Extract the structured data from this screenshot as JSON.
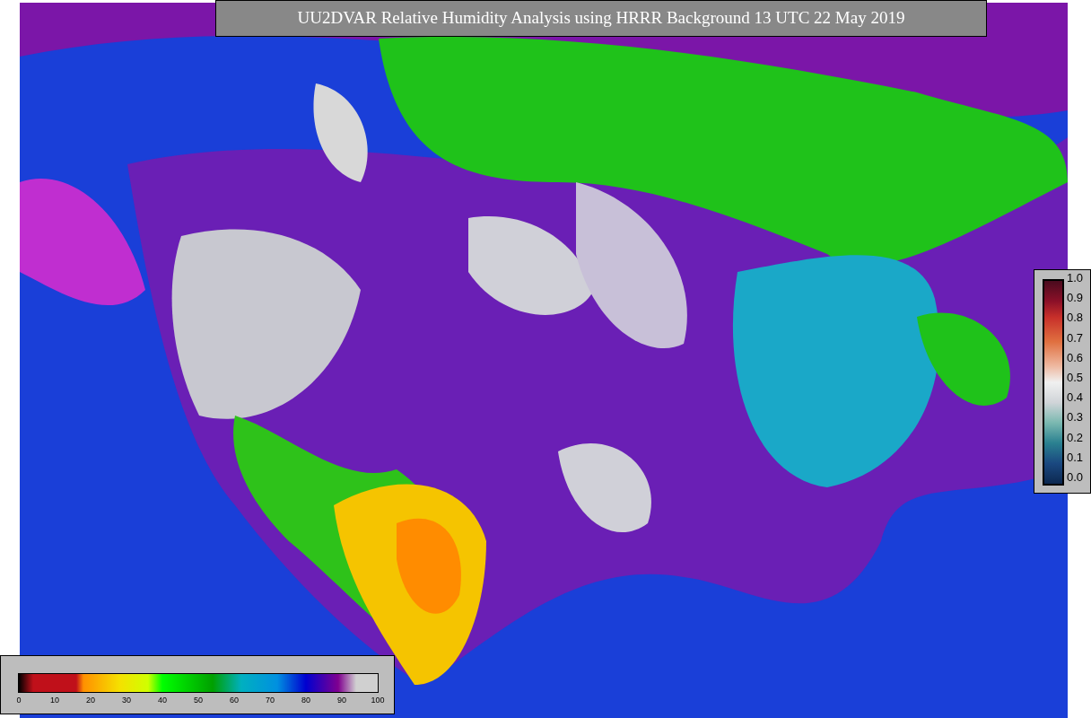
{
  "title": "UU2DVAR Relative Humidity Analysis using HRRR Background 13 UTC 22 May 2019",
  "station_colorbar": {
    "ticks": [
      "1.0",
      "0.9",
      "0.8",
      "0.7",
      "0.6",
      "0.5",
      "0.4",
      "0.3",
      "0.2",
      "0.1",
      "0.0"
    ]
  },
  "humidity_colorbar": {
    "ticks": [
      "0",
      "10",
      "20",
      "30",
      "40",
      "50",
      "60",
      "70",
      "80",
      "90",
      "100"
    ]
  }
}
